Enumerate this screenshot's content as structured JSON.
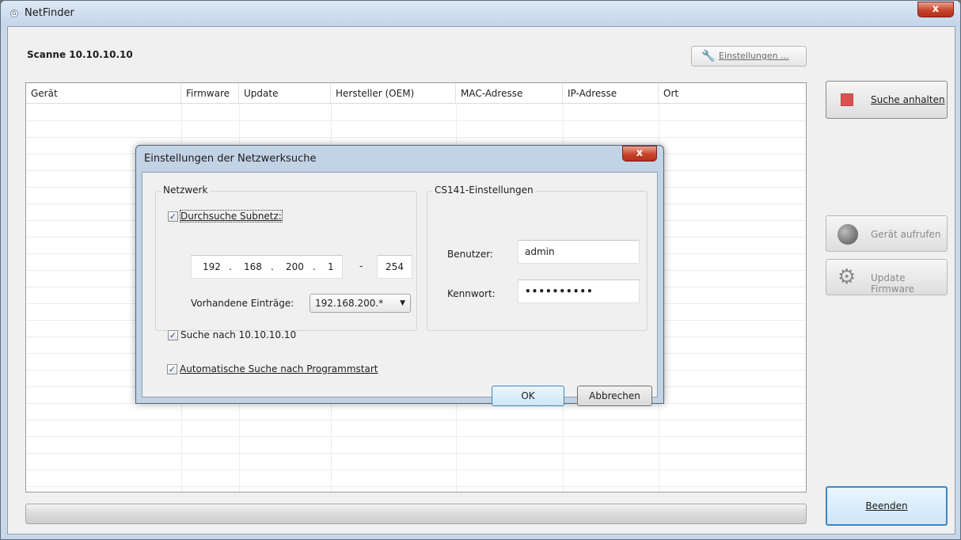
{
  "window": {
    "title": "NetFinder",
    "app_icon": "G",
    "close_glyph": "x"
  },
  "status": {
    "scan_label": "Scanne 10.10.10.10"
  },
  "toolbar": {
    "settings_label": "Einstellungen ...",
    "settings_icon": "wrench-icon"
  },
  "table": {
    "columns": [
      "Gerät",
      "Firmware",
      "Update",
      "Hersteller (OEM)",
      "MAC-Adresse",
      "IP-Adresse",
      "Ort"
    ],
    "rows": []
  },
  "progress": {
    "value": 0
  },
  "side_buttons": {
    "stop_label": "Suche anhalten",
    "device_label": "Gerät aufrufen",
    "firmware_label": "Update Firmware",
    "quit_label": "Beenden"
  },
  "dialog": {
    "title": "Einstellungen der Netzwerksuche",
    "close_glyph": "x",
    "network_group": {
      "title": "Netzwerk",
      "scan_subnet_label": "Durchsuche Subnetz:",
      "scan_subnet_checked": true,
      "ip_octets": [
        "192",
        "168",
        "200",
        "1"
      ],
      "dot": ".",
      "range_dash": "-",
      "ip_end": "254",
      "existing_label": "Vorhandene Einträge:",
      "existing_value": "192.168.200.*",
      "search_specific_label": "Suche nach 10.10.10.10",
      "search_specific_checked": true
    },
    "cs_group": {
      "title": "CS141-Einstellungen",
      "user_label": "Benutzer:",
      "user_value": "admin",
      "password_label": "Kennwort:",
      "password_value": "••••••••••"
    },
    "autostart_label": "Automatische Suche nach Programmstart",
    "autostart_checked": true,
    "ok_label": "OK",
    "cancel_label": "Abbrechen"
  }
}
